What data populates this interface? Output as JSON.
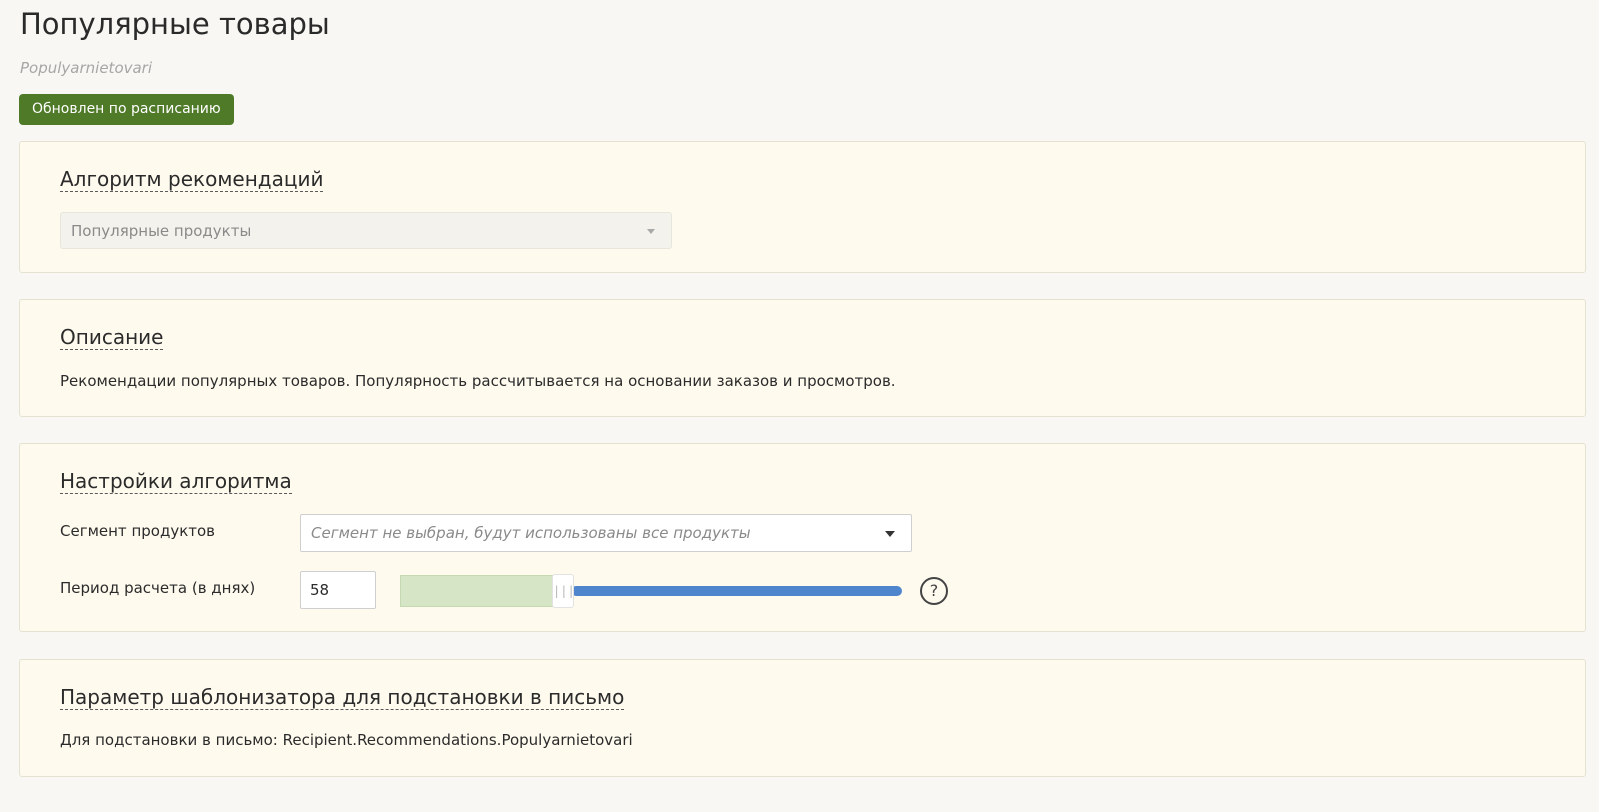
{
  "page": {
    "title": "Популярные товары",
    "subtitle": "Populyarnietovari",
    "status_badge": "Обновлен по расписанию"
  },
  "algorithm_panel": {
    "title": "Алгоритм рекомендаций",
    "select_value": "Популярные продукты",
    "select_icon": "chevron-down-icon"
  },
  "description_panel": {
    "title": "Описание",
    "text": "Рекомендации популярных товаров. Популярность рассчитывается на основании заказов и просмотров."
  },
  "settings_panel": {
    "title": "Настройки алгоритма",
    "segment_label": "Сегмент продуктов",
    "segment_placeholder": "Сегмент не выбран, будут использованы все продукты",
    "period_label": "Период расчета (в днях)",
    "period_value": "58",
    "slider_grip": "|||",
    "slider_fraction": 0.32,
    "help_text": "?"
  },
  "template_panel": {
    "title": "Параметр шаблонизатора для подстановки в письмо",
    "text": "Для подстановки в письмо: Recipient.Recommendations.Populyarnietovari"
  },
  "colors": {
    "page_background": "#f8f7f3",
    "panel_background": "#fefaee",
    "badge_green": "#4f7a28",
    "slider_blue": "#4f85cc",
    "slider_range_green": "#d5e5c5"
  }
}
